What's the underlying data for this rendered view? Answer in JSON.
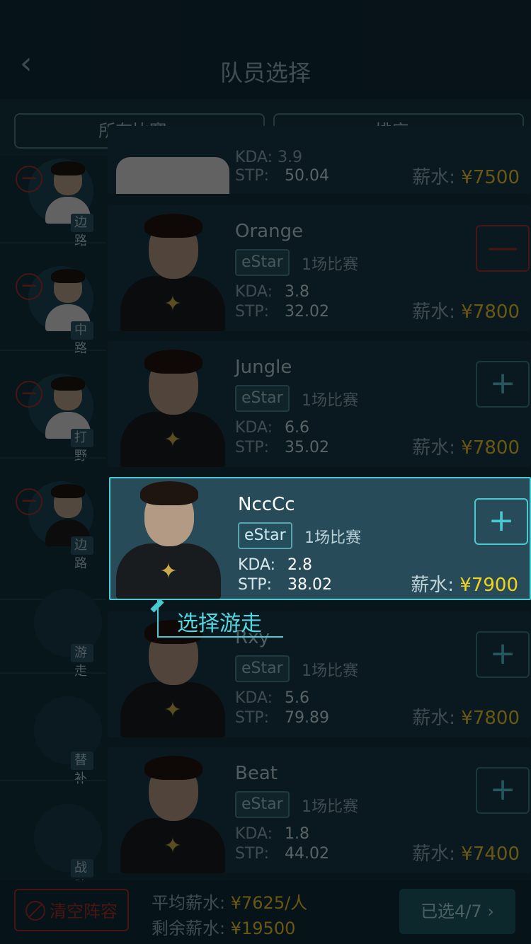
{
  "header": {
    "back_icon": "‹",
    "title": "队员选择"
  },
  "filters": {
    "match": "所有比赛",
    "sort": "排序",
    "caret": "▼"
  },
  "sidebar": {
    "remove_icon": "−",
    "slots": [
      {
        "role": "边路",
        "state": "filled"
      },
      {
        "role": "中路",
        "state": "filled"
      },
      {
        "role": "打野",
        "state": "filled"
      },
      {
        "role": "边路",
        "state": "filled"
      },
      {
        "role": "游走",
        "state": "empty"
      },
      {
        "role": "替补",
        "state": "empty"
      },
      {
        "role": "战队",
        "state": "empty"
      }
    ]
  },
  "players": [
    {
      "name": "",
      "team": "",
      "games": "",
      "kda_label": "KDA:",
      "kda": "3.9",
      "stp_label": "STP:",
      "stp": "50.04",
      "salary_label": "薪水:",
      "salary": "¥7500",
      "action": ""
    },
    {
      "name": "Orange",
      "team": "eStar",
      "games": "1场比赛",
      "kda_label": "KDA:",
      "kda": "3.8",
      "stp_label": "STP:",
      "stp": "32.02",
      "salary_label": "薪水:",
      "salary": "¥7800",
      "action": "—"
    },
    {
      "name": "Jungle",
      "team": "eStar",
      "games": "1场比赛",
      "kda_label": "KDA:",
      "kda": "6.6",
      "stp_label": "STP:",
      "stp": "35.02",
      "salary_label": "薪水:",
      "salary": "¥7800",
      "action": "+"
    },
    {
      "name": "NccCc",
      "team": "eStar",
      "games": "1场比赛",
      "kda_label": "KDA:",
      "kda": "2.8",
      "stp_label": "STP:",
      "stp": "38.02",
      "salary_label": "薪水:",
      "salary": "¥7900",
      "action": "+"
    },
    {
      "name": "Rxy",
      "team": "eStar",
      "games": "1场比赛",
      "kda_label": "KDA:",
      "kda": "5.6",
      "stp_label": "STP:",
      "stp": "79.89",
      "salary_label": "薪水:",
      "salary": "¥7800",
      "action": "+"
    },
    {
      "name": "Beat",
      "team": "eStar",
      "games": "1场比赛",
      "kda_label": "KDA:",
      "kda": "1.8",
      "stp_label": "STP:",
      "stp": "44.02",
      "salary_label": "薪水:",
      "salary": "¥7400",
      "action": "+"
    }
  ],
  "guide": {
    "text": "选择游走"
  },
  "footer": {
    "clear_label": "清空阵容",
    "avg_label": "平均薪水:",
    "avg_value": "¥7625/人",
    "remain_label": "剩余薪水:",
    "remain_value": "¥19500",
    "selected": "已选4/7",
    "chevron": "›"
  },
  "colors": {
    "accent": "#49c9d2",
    "salary": "#e8c22b",
    "danger": "#a3302c"
  }
}
